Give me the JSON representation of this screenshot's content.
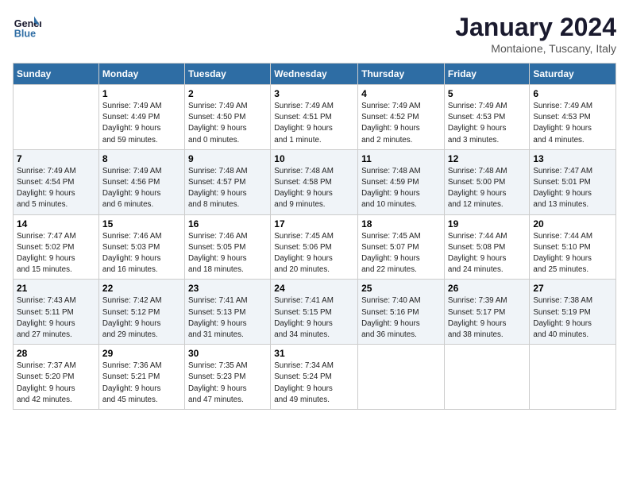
{
  "header": {
    "logo_line1": "General",
    "logo_line2": "Blue",
    "month": "January 2024",
    "location": "Montaione, Tuscany, Italy"
  },
  "days_of_week": [
    "Sunday",
    "Monday",
    "Tuesday",
    "Wednesday",
    "Thursday",
    "Friday",
    "Saturday"
  ],
  "weeks": [
    [
      {
        "day": "",
        "info": ""
      },
      {
        "day": "1",
        "info": "Sunrise: 7:49 AM\nSunset: 4:49 PM\nDaylight: 9 hours\nand 59 minutes."
      },
      {
        "day": "2",
        "info": "Sunrise: 7:49 AM\nSunset: 4:50 PM\nDaylight: 9 hours\nand 0 minutes."
      },
      {
        "day": "3",
        "info": "Sunrise: 7:49 AM\nSunset: 4:51 PM\nDaylight: 9 hours\nand 1 minute."
      },
      {
        "day": "4",
        "info": "Sunrise: 7:49 AM\nSunset: 4:52 PM\nDaylight: 9 hours\nand 2 minutes."
      },
      {
        "day": "5",
        "info": "Sunrise: 7:49 AM\nSunset: 4:53 PM\nDaylight: 9 hours\nand 3 minutes."
      },
      {
        "day": "6",
        "info": "Sunrise: 7:49 AM\nSunset: 4:53 PM\nDaylight: 9 hours\nand 4 minutes."
      }
    ],
    [
      {
        "day": "7",
        "info": "Sunrise: 7:49 AM\nSunset: 4:54 PM\nDaylight: 9 hours\nand 5 minutes."
      },
      {
        "day": "8",
        "info": "Sunrise: 7:49 AM\nSunset: 4:56 PM\nDaylight: 9 hours\nand 6 minutes."
      },
      {
        "day": "9",
        "info": "Sunrise: 7:48 AM\nSunset: 4:57 PM\nDaylight: 9 hours\nand 8 minutes."
      },
      {
        "day": "10",
        "info": "Sunrise: 7:48 AM\nSunset: 4:58 PM\nDaylight: 9 hours\nand 9 minutes."
      },
      {
        "day": "11",
        "info": "Sunrise: 7:48 AM\nSunset: 4:59 PM\nDaylight: 9 hours\nand 10 minutes."
      },
      {
        "day": "12",
        "info": "Sunrise: 7:48 AM\nSunset: 5:00 PM\nDaylight: 9 hours\nand 12 minutes."
      },
      {
        "day": "13",
        "info": "Sunrise: 7:47 AM\nSunset: 5:01 PM\nDaylight: 9 hours\nand 13 minutes."
      }
    ],
    [
      {
        "day": "14",
        "info": "Sunrise: 7:47 AM\nSunset: 5:02 PM\nDaylight: 9 hours\nand 15 minutes."
      },
      {
        "day": "15",
        "info": "Sunrise: 7:46 AM\nSunset: 5:03 PM\nDaylight: 9 hours\nand 16 minutes."
      },
      {
        "day": "16",
        "info": "Sunrise: 7:46 AM\nSunset: 5:05 PM\nDaylight: 9 hours\nand 18 minutes."
      },
      {
        "day": "17",
        "info": "Sunrise: 7:45 AM\nSunset: 5:06 PM\nDaylight: 9 hours\nand 20 minutes."
      },
      {
        "day": "18",
        "info": "Sunrise: 7:45 AM\nSunset: 5:07 PM\nDaylight: 9 hours\nand 22 minutes."
      },
      {
        "day": "19",
        "info": "Sunrise: 7:44 AM\nSunset: 5:08 PM\nDaylight: 9 hours\nand 24 minutes."
      },
      {
        "day": "20",
        "info": "Sunrise: 7:44 AM\nSunset: 5:10 PM\nDaylight: 9 hours\nand 25 minutes."
      }
    ],
    [
      {
        "day": "21",
        "info": "Sunrise: 7:43 AM\nSunset: 5:11 PM\nDaylight: 9 hours\nand 27 minutes."
      },
      {
        "day": "22",
        "info": "Sunrise: 7:42 AM\nSunset: 5:12 PM\nDaylight: 9 hours\nand 29 minutes."
      },
      {
        "day": "23",
        "info": "Sunrise: 7:41 AM\nSunset: 5:13 PM\nDaylight: 9 hours\nand 31 minutes."
      },
      {
        "day": "24",
        "info": "Sunrise: 7:41 AM\nSunset: 5:15 PM\nDaylight: 9 hours\nand 34 minutes."
      },
      {
        "day": "25",
        "info": "Sunrise: 7:40 AM\nSunset: 5:16 PM\nDaylight: 9 hours\nand 36 minutes."
      },
      {
        "day": "26",
        "info": "Sunrise: 7:39 AM\nSunset: 5:17 PM\nDaylight: 9 hours\nand 38 minutes."
      },
      {
        "day": "27",
        "info": "Sunrise: 7:38 AM\nSunset: 5:19 PM\nDaylight: 9 hours\nand 40 minutes."
      }
    ],
    [
      {
        "day": "28",
        "info": "Sunrise: 7:37 AM\nSunset: 5:20 PM\nDaylight: 9 hours\nand 42 minutes."
      },
      {
        "day": "29",
        "info": "Sunrise: 7:36 AM\nSunset: 5:21 PM\nDaylight: 9 hours\nand 45 minutes."
      },
      {
        "day": "30",
        "info": "Sunrise: 7:35 AM\nSunset: 5:23 PM\nDaylight: 9 hours\nand 47 minutes."
      },
      {
        "day": "31",
        "info": "Sunrise: 7:34 AM\nSunset: 5:24 PM\nDaylight: 9 hours\nand 49 minutes."
      },
      {
        "day": "",
        "info": ""
      },
      {
        "day": "",
        "info": ""
      },
      {
        "day": "",
        "info": ""
      }
    ]
  ]
}
